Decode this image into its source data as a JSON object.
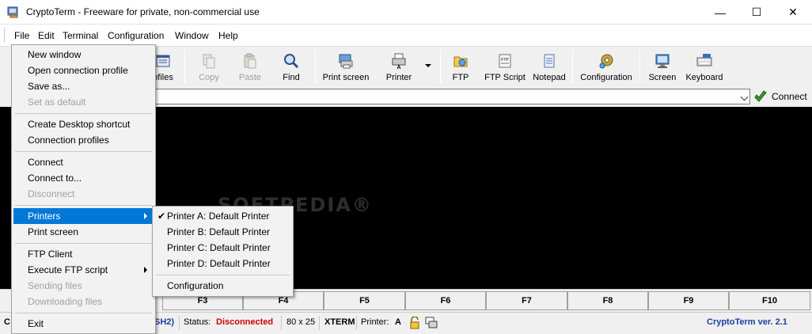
{
  "window": {
    "title": "CryptoTerm - Freeware for private, non-commercial use",
    "min_glyph": "—",
    "max_glyph": "☐",
    "close_glyph": "✕"
  },
  "menubar": {
    "items": [
      {
        "label": "File"
      },
      {
        "label": "Edit"
      },
      {
        "label": "Terminal"
      },
      {
        "label": "Configuration"
      },
      {
        "label": "Window"
      },
      {
        "label": "Help"
      }
    ]
  },
  "toolbar": {
    "profiles_partial": "ofiles",
    "copy": "Copy",
    "paste": "Paste",
    "find": "Find",
    "print_screen": "Print screen",
    "printer": "Printer",
    "ftp": "FTP",
    "ftp_script": "FTP Script",
    "notepad": "Notepad",
    "configuration": "Configuration",
    "screen": "Screen",
    "keyboard": "Keyboard"
  },
  "connect_bar": {
    "host_value": "",
    "connect_label": "Connect"
  },
  "terminal": {
    "watermark": "SOFTPEDIA®"
  },
  "function_keys": [
    "F3",
    "F4",
    "F5",
    "F6",
    "F7",
    "F8",
    "F9",
    "F10"
  ],
  "statusbar": {
    "left_partial_start": "C",
    "left_partial_end": "SH2)",
    "status_label": "Status:",
    "status_value": "Disconnected",
    "size": "80 x 25",
    "emulation": "XTERM",
    "printer_label": "Printer:",
    "printer_value": "A",
    "version": "CryptoTerm ver. 2.1"
  },
  "file_menu": {
    "new_window": "New window",
    "open_profile": "Open connection profile",
    "save_as": "Save as...",
    "set_default": "Set as default",
    "desktop_shortcut": "Create Desktop shortcut",
    "connection_profiles": "Connection profiles",
    "connect": "Connect",
    "connect_to": "Connect to...",
    "disconnect": "Disconnect",
    "printers": "Printers",
    "print_screen": "Print screen",
    "ftp_client": "FTP Client",
    "execute_ftp": "Execute FTP script",
    "sending_files": "Sending files",
    "downloading_files": "Downloading files",
    "exit": "Exit"
  },
  "printers_submenu": {
    "check_glyph": "✔",
    "printer_a": "Printer A: Default Printer",
    "printer_b": "Printer B: Default Printer",
    "printer_c": "Printer C: Default Printer",
    "printer_d": "Printer D: Default Printer",
    "configuration": "Configuration"
  },
  "colors": {
    "highlight": "#0078d7",
    "status_disconnected": "#d40000",
    "version_text": "#1a3fa0",
    "terminal_bg": "#000000"
  }
}
